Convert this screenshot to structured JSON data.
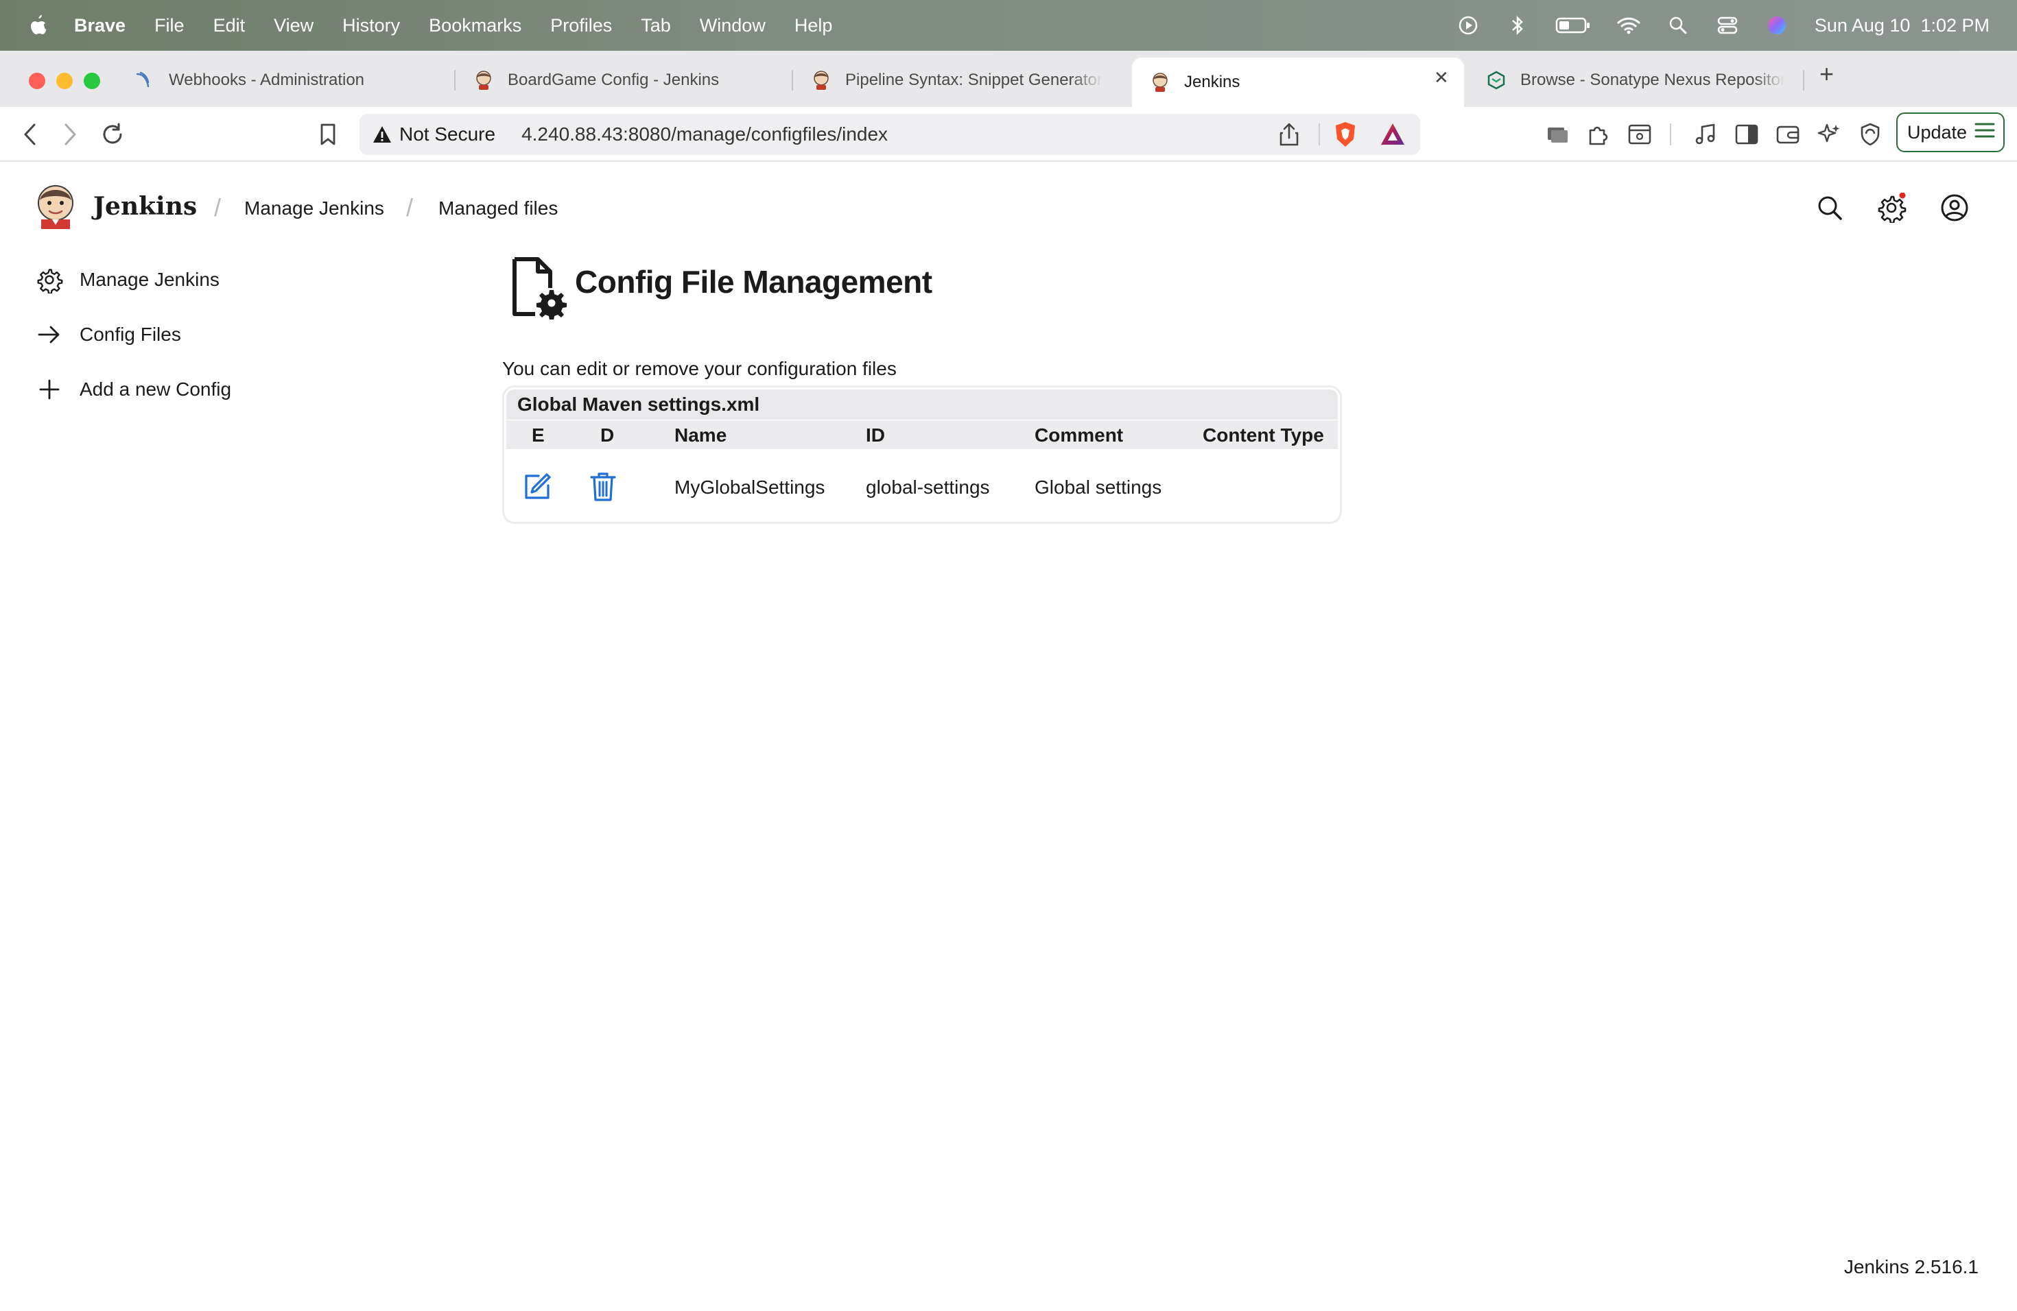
{
  "menubar": {
    "app": "Brave",
    "items": [
      "File",
      "Edit",
      "View",
      "History",
      "Bookmarks",
      "Profiles",
      "Tab",
      "Window",
      "Help"
    ],
    "clock": "Sun Aug 10  1:02 PM"
  },
  "tabs": [
    {
      "label": "Webhooks - Administration",
      "icon": "webhook-icon"
    },
    {
      "label": "BoardGame Config - Jenkins",
      "icon": "jenkins-icon"
    },
    {
      "label": "Pipeline Syntax: Snippet Generator",
      "icon": "jenkins-icon"
    },
    {
      "label": "Jenkins",
      "icon": "jenkins-icon",
      "active": true
    },
    {
      "label": "Browse - Sonatype Nexus Repository",
      "icon": "nexus-icon"
    }
  ],
  "toolbar": {
    "security": "Not Secure",
    "url": "4.240.88.43:8080/manage/configfiles/index",
    "update_label": "Update"
  },
  "header": {
    "brand": "Jenkins",
    "breadcrumbs": [
      "Manage Jenkins",
      "Managed files"
    ]
  },
  "sidebar": {
    "items": [
      {
        "label": "Manage Jenkins",
        "icon": "gear-icon"
      },
      {
        "label": "Config Files",
        "icon": "arrow-right-icon"
      },
      {
        "label": "Add a new Config",
        "icon": "plus-icon"
      }
    ]
  },
  "main": {
    "title": "Config File Management",
    "intro": "You can edit or remove your configuration files",
    "section": "Global Maven settings.xml",
    "columns": [
      "E",
      "D",
      "Name",
      "ID",
      "Comment",
      "Content Type"
    ],
    "rows": [
      {
        "name": "MyGlobalSettings",
        "id": "global-settings",
        "comment": "Global settings",
        "content_type": ""
      }
    ]
  },
  "footer": {
    "version": "Jenkins 2.516.1"
  },
  "colors": {
    "accent_blue": "#1f6fd6",
    "notification_red": "#e0281b",
    "update_border": "#2c6e3b"
  }
}
